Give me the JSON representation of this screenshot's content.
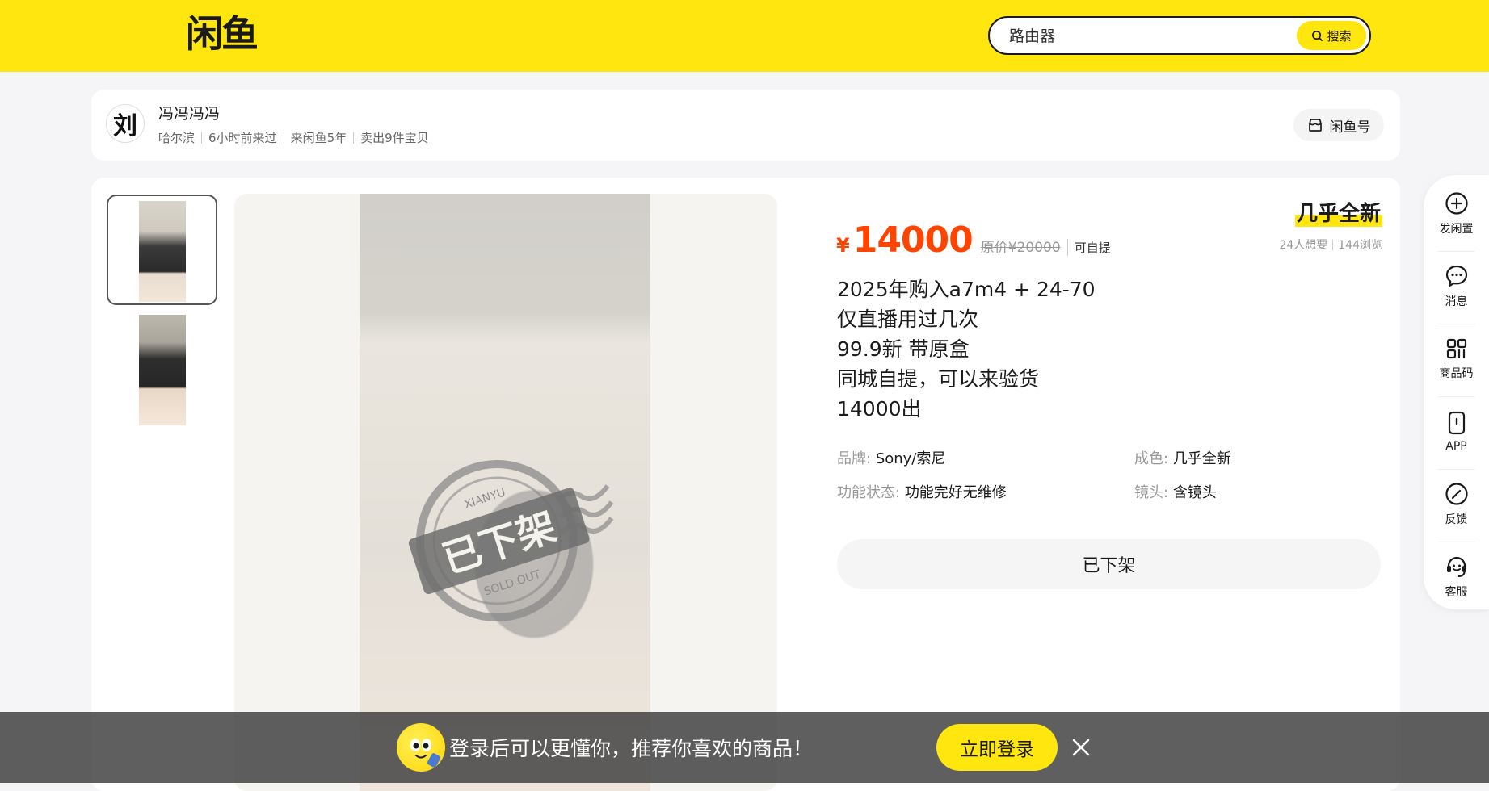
{
  "header": {
    "logo_text": "闲鱼",
    "search_placeholder": "路由器",
    "search_button": "搜索"
  },
  "seller": {
    "avatar_char": "刘",
    "name": "冯冯冯冯",
    "location": "哈尔滨",
    "last_seen": "6小时前来过",
    "years": "来闲鱼5年",
    "sold": "卖出9件宝贝",
    "shop_button": "闲鱼号"
  },
  "product": {
    "currency": "¥",
    "price": "14000",
    "original_price": "原价¥20000",
    "pickup": "可自提",
    "condition_tag": "几乎全新",
    "wants": "24人想要",
    "views": "144浏览",
    "description": [
      "2025年购入a7m4 + 24-70",
      "仅直播用过几次",
      "99.9新 带原盒",
      "同城自提，可以来验货",
      "14000出"
    ],
    "attributes": [
      {
        "key": "品牌:",
        "value": "Sony/索尼"
      },
      {
        "key": "成色:",
        "value": "几乎全新"
      },
      {
        "key": "功能状态:",
        "value": "功能完好无维修"
      },
      {
        "key": "镜头:",
        "value": "含镜头"
      }
    ],
    "status_button": "已下架",
    "stamp_text": "已下架",
    "stamp_top": "XIANYU",
    "stamp_bottom": "SOLD OUT"
  },
  "sidebar": {
    "items": [
      {
        "label": "发闲置",
        "icon": "plus-circle-icon"
      },
      {
        "label": "消息",
        "icon": "chat-bubble-icon"
      },
      {
        "label": "商品码",
        "icon": "grid-code-icon"
      },
      {
        "label": "APP",
        "icon": "phone-icon"
      },
      {
        "label": "反馈",
        "icon": "feedback-icon"
      },
      {
        "label": "客服",
        "icon": "headset-icon"
      }
    ]
  },
  "banner": {
    "text": "登录后可以更懂你，推荐你喜欢的商品！",
    "login_button": "立即登录"
  },
  "colors": {
    "brand_yellow": "#ffe60f",
    "price_orange": "#ff4400"
  }
}
